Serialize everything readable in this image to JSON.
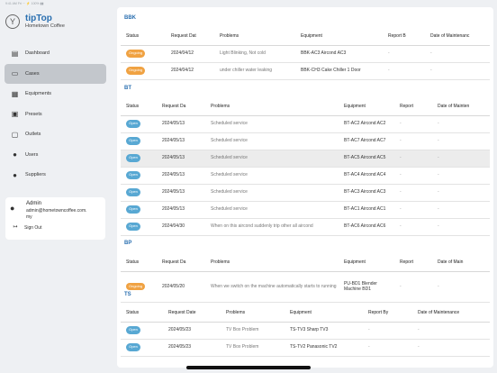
{
  "statusbar": {
    "text": "9:41 AM Fri  ···  ⚡ 100% ▮▮"
  },
  "brand": {
    "icon": "cocktail-logo-icon",
    "name": "tipTop",
    "subtitle": "Hometown Coffee"
  },
  "nav": [
    {
      "label": "Dashboard",
      "icon": "dashboard-icon",
      "glyph": "▤"
    },
    {
      "label": "Cases",
      "icon": "folder-icon",
      "glyph": "▭"
    },
    {
      "label": "Equipments",
      "icon": "equipment-icon",
      "glyph": "▦"
    },
    {
      "label": "Presets",
      "icon": "presets-icon",
      "glyph": "▣"
    },
    {
      "label": "Outlets",
      "icon": "outlets-icon",
      "glyph": "▢"
    },
    {
      "label": "Users",
      "icon": "users-icon",
      "glyph": "●"
    },
    {
      "label": "Suppliers",
      "icon": "suppliers-icon",
      "glyph": "●"
    }
  ],
  "user": {
    "name": "Admin",
    "email": "admin@hometowncoffee.com.my",
    "signout": "Sign Out"
  },
  "sections": [
    {
      "title": "BBK",
      "headers": [
        "Status",
        "Request Dat",
        "Problems",
        "Equipment",
        "Report B",
        "Date of Maintenanc"
      ],
      "rows": [
        {
          "status": "Ongoing",
          "date": "2024/04/12",
          "problem": "Light Blinking, Not cold",
          "equipment": "BBK-AC3 Aircond AC3",
          "report": "-",
          "maint": "-"
        },
        {
          "status": "Ongoing",
          "date": "2024/04/12",
          "problem": "under chiller water leaking",
          "equipment": "BBK-CH3 Cake Chiller 1 Door",
          "report": "-",
          "maint": "-"
        }
      ]
    },
    {
      "title": "BT",
      "headers": [
        "Status",
        "Request Da",
        "Problems",
        "Equipment",
        "Report",
        "Date of Mainten"
      ],
      "rows": [
        {
          "status": "Open",
          "date": "2024/05/13",
          "problem": "Scheduled service",
          "equipment": "BT-AC2 Aircond AC2",
          "report": "-",
          "maint": "-"
        },
        {
          "status": "Open",
          "date": "2024/05/13",
          "problem": "Scheduled service",
          "equipment": "BT-AC7 Aircond AC7",
          "report": "-",
          "maint": "-"
        },
        {
          "status": "Open",
          "date": "2024/05/13",
          "problem": "Scheduled service",
          "equipment": "BT-AC5 Aircond AC5",
          "report": "-",
          "maint": "-"
        },
        {
          "status": "Open",
          "date": "2024/05/13",
          "problem": "Scheduled service",
          "equipment": "BT-AC4 Aircond AC4",
          "report": "-",
          "maint": "-"
        },
        {
          "status": "Open",
          "date": "2024/05/13",
          "problem": "Scheduled service",
          "equipment": "BT-AC3 Aircond AC3",
          "report": "-",
          "maint": "-"
        },
        {
          "status": "Open",
          "date": "2024/05/13",
          "problem": "Scheduled service",
          "equipment": "BT-AC1 Aircond AC1",
          "report": "-",
          "maint": "-"
        },
        {
          "status": "Open",
          "date": "2024/04/30",
          "problem": "When on this aircond suddenly trip other all aircond",
          "equipment": "BT-AC6 Aircond AC6",
          "report": "-",
          "maint": "-"
        }
      ]
    },
    {
      "title": "BP",
      "headers": [
        "Status",
        "Request Da",
        "Problems",
        "Equipment",
        "Report",
        "Date of Main"
      ],
      "rows": [
        {
          "status": "Ongoing",
          "date": "2024/05/20",
          "problem": "When we switch on the machine automatically starts to running",
          "equipment": "PU-BD1 Blender Machine BD1",
          "report": "-",
          "maint": "-"
        }
      ]
    },
    {
      "title": "TS",
      "headers": [
        "Status",
        "Request Date",
        "Problems",
        "Equipment",
        "Report By",
        "Date of Maintenance"
      ],
      "rows": [
        {
          "status": "Open",
          "date": "2024/05/23",
          "problem": "TV Box Problem",
          "equipment": "TS-TV3 Sharp TV3",
          "report": "-",
          "maint": "-"
        },
        {
          "status": "Open",
          "date": "2024/05/23",
          "problem": "TV Box Problem",
          "equipment": "TS-TV2 Panasonic TV2",
          "report": "-",
          "maint": "-"
        }
      ]
    }
  ],
  "colors": {
    "accent": "#2a6fb0",
    "ongoing": "#f0a242",
    "open": "#58a8d3"
  }
}
